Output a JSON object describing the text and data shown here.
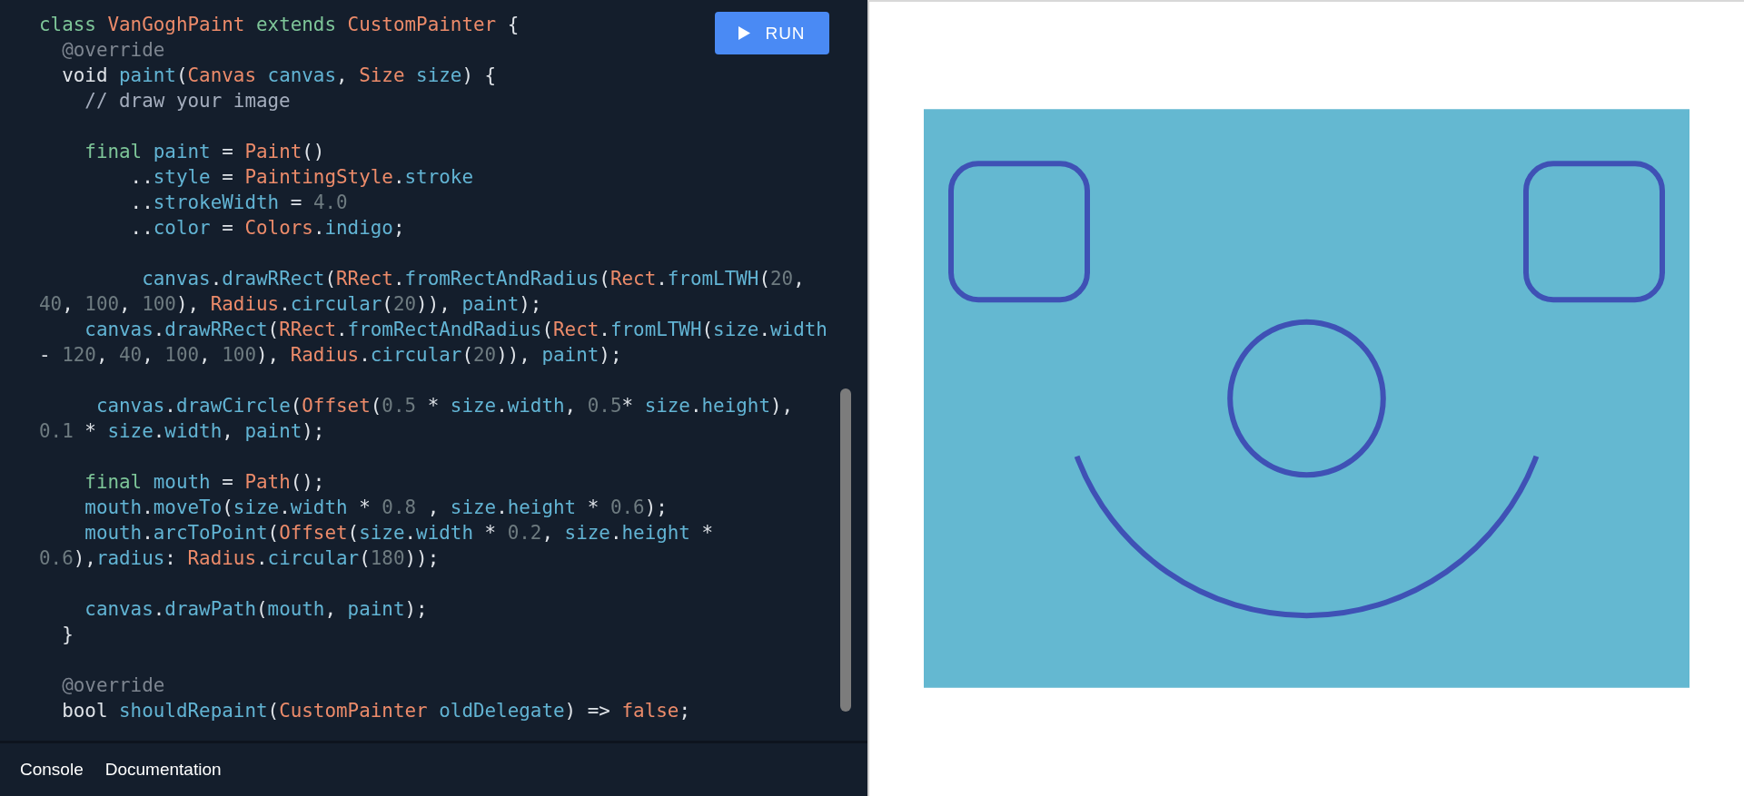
{
  "editor": {
    "code_blocks": [
      [
        [
          {
            "kind": "keyword",
            "text": "class "
          },
          {
            "kind": "type",
            "text": "VanGoghPaint "
          },
          {
            "kind": "keyword",
            "text": "extends "
          },
          {
            "kind": "type",
            "text": "CustomPainter "
          },
          {
            "kind": "plain",
            "text": "{"
          }
        ],
        [
          {
            "kind": "annotation",
            "text": "  @override"
          }
        ],
        [
          {
            "kind": "plain",
            "text": "  void "
          },
          {
            "kind": "identifier",
            "text": "paint"
          },
          {
            "kind": "plain",
            "text": "("
          },
          {
            "kind": "type",
            "text": "Canvas "
          },
          {
            "kind": "identifier",
            "text": "canvas"
          },
          {
            "kind": "plain",
            "text": ", "
          },
          {
            "kind": "type",
            "text": "Size "
          },
          {
            "kind": "identifier",
            "text": "size"
          },
          {
            "kind": "plain",
            "text": ") {"
          }
        ],
        [
          {
            "kind": "comment",
            "text": "    // draw your image"
          }
        ]
      ],
      [
        [
          {
            "kind": "keyword",
            "text": "    final "
          },
          {
            "kind": "identifier",
            "text": "paint"
          },
          {
            "kind": "plain",
            "text": " = "
          },
          {
            "kind": "type",
            "text": "Paint"
          },
          {
            "kind": "plain",
            "text": "()"
          }
        ],
        [
          {
            "kind": "plain",
            "text": "        .."
          },
          {
            "kind": "identifier",
            "text": "style"
          },
          {
            "kind": "plain",
            "text": " = "
          },
          {
            "kind": "type",
            "text": "PaintingStyle"
          },
          {
            "kind": "plain",
            "text": "."
          },
          {
            "kind": "identifier",
            "text": "stroke"
          }
        ],
        [
          {
            "kind": "plain",
            "text": "        .."
          },
          {
            "kind": "identifier",
            "text": "strokeWidth"
          },
          {
            "kind": "plain",
            "text": " = "
          },
          {
            "kind": "number",
            "text": "4.0"
          }
        ],
        [
          {
            "kind": "plain",
            "text": "        .."
          },
          {
            "kind": "identifier",
            "text": "color"
          },
          {
            "kind": "plain",
            "text": " = "
          },
          {
            "kind": "type",
            "text": "Colors"
          },
          {
            "kind": "plain",
            "text": "."
          },
          {
            "kind": "identifier",
            "text": "indigo"
          },
          {
            "kind": "plain",
            "text": ";"
          }
        ]
      ],
      [
        [
          {
            "kind": "identifier",
            "text": "         canvas"
          },
          {
            "kind": "plain",
            "text": "."
          },
          {
            "kind": "identifier",
            "text": "drawRRect"
          },
          {
            "kind": "plain",
            "text": "("
          },
          {
            "kind": "type",
            "text": "RRect"
          },
          {
            "kind": "plain",
            "text": "."
          },
          {
            "kind": "identifier",
            "text": "fromRectAndRadius"
          },
          {
            "kind": "plain",
            "text": "("
          },
          {
            "kind": "type",
            "text": "Rect"
          },
          {
            "kind": "plain",
            "text": "."
          },
          {
            "kind": "identifier",
            "text": "fromLTWH"
          },
          {
            "kind": "plain",
            "text": "("
          },
          {
            "kind": "number",
            "text": "20"
          },
          {
            "kind": "plain",
            "text": ","
          }
        ],
        [
          {
            "kind": "number",
            "text": "40"
          },
          {
            "kind": "plain",
            "text": ", "
          },
          {
            "kind": "number",
            "text": "100"
          },
          {
            "kind": "plain",
            "text": ", "
          },
          {
            "kind": "number",
            "text": "100"
          },
          {
            "kind": "plain",
            "text": "), "
          },
          {
            "kind": "type",
            "text": "Radius"
          },
          {
            "kind": "plain",
            "text": "."
          },
          {
            "kind": "identifier",
            "text": "circular"
          },
          {
            "kind": "plain",
            "text": "("
          },
          {
            "kind": "number",
            "text": "20"
          },
          {
            "kind": "plain",
            "text": ")), "
          },
          {
            "kind": "identifier",
            "text": "paint"
          },
          {
            "kind": "plain",
            "text": ");"
          }
        ],
        [
          {
            "kind": "identifier",
            "text": "    canvas"
          },
          {
            "kind": "plain",
            "text": "."
          },
          {
            "kind": "identifier",
            "text": "drawRRect"
          },
          {
            "kind": "plain",
            "text": "("
          },
          {
            "kind": "type",
            "text": "RRect"
          },
          {
            "kind": "plain",
            "text": "."
          },
          {
            "kind": "identifier",
            "text": "fromRectAndRadius"
          },
          {
            "kind": "plain",
            "text": "("
          },
          {
            "kind": "type",
            "text": "Rect"
          },
          {
            "kind": "plain",
            "text": "."
          },
          {
            "kind": "identifier",
            "text": "fromLTWH"
          },
          {
            "kind": "plain",
            "text": "("
          },
          {
            "kind": "identifier",
            "text": "size"
          },
          {
            "kind": "plain",
            "text": "."
          },
          {
            "kind": "identifier",
            "text": "width"
          }
        ],
        [
          {
            "kind": "plain",
            "text": "- "
          },
          {
            "kind": "number",
            "text": "120"
          },
          {
            "kind": "plain",
            "text": ", "
          },
          {
            "kind": "number",
            "text": "40"
          },
          {
            "kind": "plain",
            "text": ", "
          },
          {
            "kind": "number",
            "text": "100"
          },
          {
            "kind": "plain",
            "text": ", "
          },
          {
            "kind": "number",
            "text": "100"
          },
          {
            "kind": "plain",
            "text": "), "
          },
          {
            "kind": "type",
            "text": "Radius"
          },
          {
            "kind": "plain",
            "text": "."
          },
          {
            "kind": "identifier",
            "text": "circular"
          },
          {
            "kind": "plain",
            "text": "("
          },
          {
            "kind": "number",
            "text": "20"
          },
          {
            "kind": "plain",
            "text": ")), "
          },
          {
            "kind": "identifier",
            "text": "paint"
          },
          {
            "kind": "plain",
            "text": ");"
          }
        ]
      ],
      [
        [
          {
            "kind": "identifier",
            "text": "     canvas"
          },
          {
            "kind": "plain",
            "text": "."
          },
          {
            "kind": "identifier",
            "text": "drawCircle"
          },
          {
            "kind": "plain",
            "text": "("
          },
          {
            "kind": "type",
            "text": "Offset"
          },
          {
            "kind": "plain",
            "text": "("
          },
          {
            "kind": "number",
            "text": "0.5"
          },
          {
            "kind": "plain",
            "text": " * "
          },
          {
            "kind": "identifier",
            "text": "size"
          },
          {
            "kind": "plain",
            "text": "."
          },
          {
            "kind": "identifier",
            "text": "width"
          },
          {
            "kind": "plain",
            "text": ", "
          },
          {
            "kind": "number",
            "text": "0.5"
          },
          {
            "kind": "plain",
            "text": "* "
          },
          {
            "kind": "identifier",
            "text": "size"
          },
          {
            "kind": "plain",
            "text": "."
          },
          {
            "kind": "identifier",
            "text": "height"
          },
          {
            "kind": "plain",
            "text": "),"
          }
        ],
        [
          {
            "kind": "number",
            "text": "0.1"
          },
          {
            "kind": "plain",
            "text": " * "
          },
          {
            "kind": "identifier",
            "text": "size"
          },
          {
            "kind": "plain",
            "text": "."
          },
          {
            "kind": "identifier",
            "text": "width"
          },
          {
            "kind": "plain",
            "text": ", "
          },
          {
            "kind": "identifier",
            "text": "paint"
          },
          {
            "kind": "plain",
            "text": ");"
          }
        ]
      ],
      [
        [
          {
            "kind": "keyword",
            "text": "    final "
          },
          {
            "kind": "identifier",
            "text": "mouth"
          },
          {
            "kind": "plain",
            "text": " = "
          },
          {
            "kind": "type",
            "text": "Path"
          },
          {
            "kind": "plain",
            "text": "();"
          }
        ],
        [
          {
            "kind": "identifier",
            "text": "    mouth"
          },
          {
            "kind": "plain",
            "text": "."
          },
          {
            "kind": "identifier",
            "text": "moveTo"
          },
          {
            "kind": "plain",
            "text": "("
          },
          {
            "kind": "identifier",
            "text": "size"
          },
          {
            "kind": "plain",
            "text": "."
          },
          {
            "kind": "identifier",
            "text": "width"
          },
          {
            "kind": "plain",
            "text": " * "
          },
          {
            "kind": "number",
            "text": "0.8"
          },
          {
            "kind": "plain",
            "text": " , "
          },
          {
            "kind": "identifier",
            "text": "size"
          },
          {
            "kind": "plain",
            "text": "."
          },
          {
            "kind": "identifier",
            "text": "height"
          },
          {
            "kind": "plain",
            "text": " * "
          },
          {
            "kind": "number",
            "text": "0.6"
          },
          {
            "kind": "plain",
            "text": ");"
          }
        ],
        [
          {
            "kind": "identifier",
            "text": "    mouth"
          },
          {
            "kind": "plain",
            "text": "."
          },
          {
            "kind": "identifier",
            "text": "arcToPoint"
          },
          {
            "kind": "plain",
            "text": "("
          },
          {
            "kind": "type",
            "text": "Offset"
          },
          {
            "kind": "plain",
            "text": "("
          },
          {
            "kind": "identifier",
            "text": "size"
          },
          {
            "kind": "plain",
            "text": "."
          },
          {
            "kind": "identifier",
            "text": "width"
          },
          {
            "kind": "plain",
            "text": " * "
          },
          {
            "kind": "number",
            "text": "0.2"
          },
          {
            "kind": "plain",
            "text": ", "
          },
          {
            "kind": "identifier",
            "text": "size"
          },
          {
            "kind": "plain",
            "text": "."
          },
          {
            "kind": "identifier",
            "text": "height"
          },
          {
            "kind": "plain",
            "text": " *"
          }
        ],
        [
          {
            "kind": "number",
            "text": "0.6"
          },
          {
            "kind": "plain",
            "text": "),"
          },
          {
            "kind": "identifier",
            "text": "radius"
          },
          {
            "kind": "plain",
            "text": ": "
          },
          {
            "kind": "type",
            "text": "Radius"
          },
          {
            "kind": "plain",
            "text": "."
          },
          {
            "kind": "identifier",
            "text": "circular"
          },
          {
            "kind": "plain",
            "text": "("
          },
          {
            "kind": "number",
            "text": "180"
          },
          {
            "kind": "plain",
            "text": "));"
          }
        ]
      ],
      [
        [
          {
            "kind": "identifier",
            "text": "    canvas"
          },
          {
            "kind": "plain",
            "text": "."
          },
          {
            "kind": "identifier",
            "text": "drawPath"
          },
          {
            "kind": "plain",
            "text": "("
          },
          {
            "kind": "identifier",
            "text": "mouth"
          },
          {
            "kind": "plain",
            "text": ", "
          },
          {
            "kind": "identifier",
            "text": "paint"
          },
          {
            "kind": "plain",
            "text": ");"
          }
        ],
        [
          {
            "kind": "plain",
            "text": "  }"
          }
        ]
      ],
      [
        [
          {
            "kind": "annotation",
            "text": "  @override"
          }
        ],
        [
          {
            "kind": "plain",
            "text": "  bool "
          },
          {
            "kind": "identifier",
            "text": "shouldRepaint"
          },
          {
            "kind": "plain",
            "text": "("
          },
          {
            "kind": "type",
            "text": "CustomPainter "
          },
          {
            "kind": "identifier",
            "text": "oldDelegate"
          },
          {
            "kind": "plain",
            "text": ") => "
          },
          {
            "kind": "type",
            "text": "false"
          },
          {
            "kind": "plain",
            "text": ";"
          }
        ]
      ]
    ],
    "run_button": {
      "label": "RUN"
    }
  },
  "bottom_tabs": [
    "Console",
    "Documentation"
  ]
}
